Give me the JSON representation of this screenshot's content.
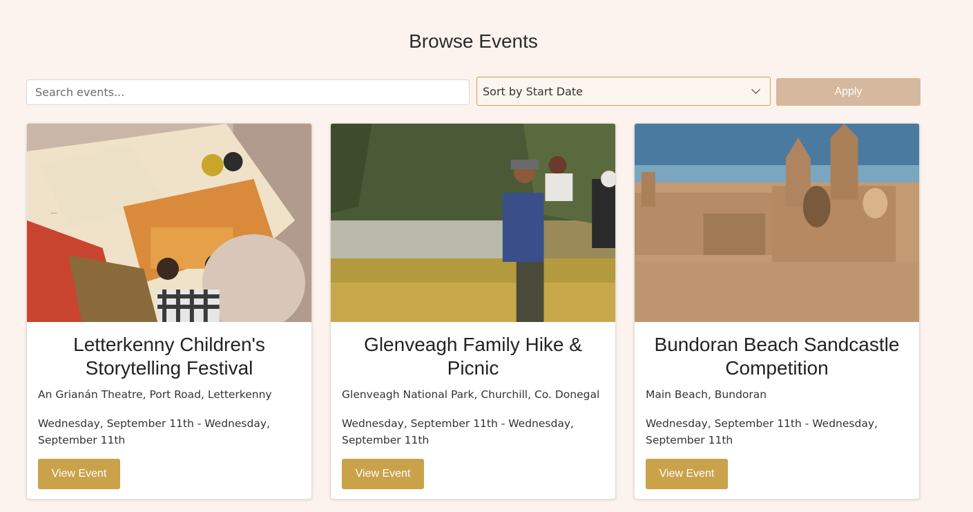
{
  "header": {
    "title": "Browse Events"
  },
  "filters": {
    "search_placeholder": "Search events...",
    "search_value": "",
    "sort_selected": "Sort by Start Date",
    "apply_label": "Apply"
  },
  "colors": {
    "background": "#fcf3ee",
    "accent": "#c9a24a",
    "apply_button": "#d5b89e"
  },
  "events": [
    {
      "title": "Letterkenny Children's Storytelling Festival",
      "location": "An Grianán Theatre, Port Road, Letterkenny",
      "date": "Wednesday, September 11th - Wednesday, September 11th",
      "button": "View Event",
      "image": "child-reading-picture-book-photo"
    },
    {
      "title": "Glenveagh Family Hike & Picnic",
      "location": "Glenveagh National Park, Churchill, Co. Donegal",
      "date": "Wednesday, September 11th - Wednesday, September 11th",
      "button": "View Event",
      "image": "family-hiking-by-lake-photo"
    },
    {
      "title": "Bundoran Beach Sandcastle Competition",
      "location": "Main Beach, Bundoran",
      "date": "Wednesday, September 11th - Wednesday, September 11th",
      "button": "View Event",
      "image": "sandcastle-on-beach-photo"
    }
  ]
}
